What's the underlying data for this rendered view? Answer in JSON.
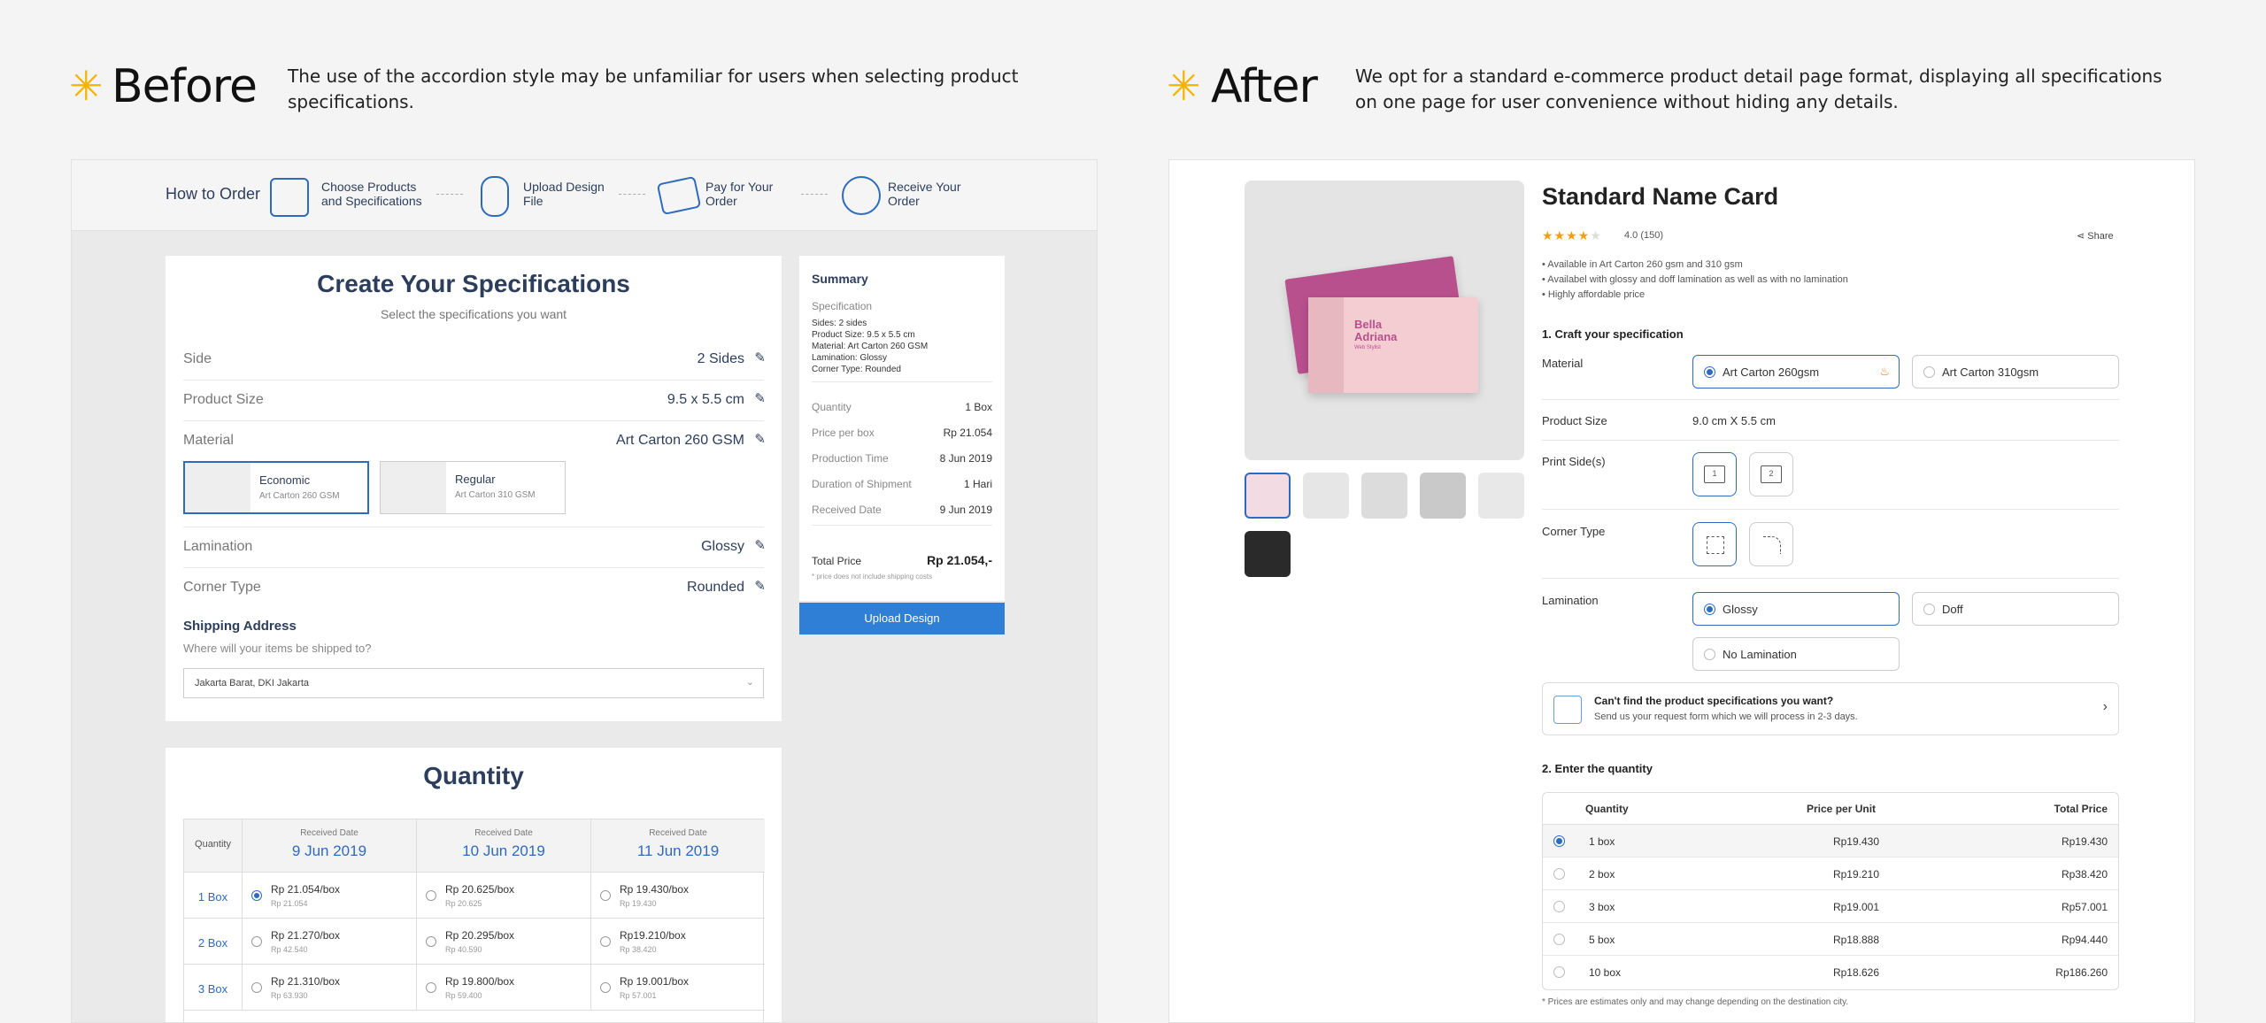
{
  "before": {
    "heading": "Before",
    "description_line1": "The use of the accordion style may be unfamiliar for users when selecting product",
    "description_line2": "specifications.",
    "how_to_order": {
      "label": "How to Order",
      "steps": [
        {
          "line1": "Choose Products",
          "line2": "and Specifications",
          "icon": "computer-icon"
        },
        {
          "line1": "Upload Design",
          "line2": "File",
          "icon": "upload-file-icon"
        },
        {
          "line1": "Pay for Your",
          "line2": "Order",
          "icon": "credit-card-icon"
        },
        {
          "line1": "Receive Your",
          "line2": "Order",
          "icon": "delivery-icon"
        }
      ]
    },
    "spec": {
      "title": "Create Your Specifications",
      "subtitle": "Select the specifications you want",
      "rows": [
        {
          "label": "Side",
          "value": "2 Sides"
        },
        {
          "label": "Product Size",
          "value": "9.5 x 5.5 cm"
        },
        {
          "label": "Material",
          "value": "Art Carton 260 GSM"
        }
      ],
      "materials": [
        {
          "name": "Economic",
          "desc": "Art Carton 260 GSM",
          "selected": true
        },
        {
          "name": "Regular",
          "desc": "Art Carton 310 GSM",
          "selected": false
        }
      ],
      "rows2": [
        {
          "label": "Lamination",
          "value": "Glossy"
        },
        {
          "label": "Corner Type",
          "value": "Rounded"
        }
      ],
      "shipping_title": "Shipping Address",
      "shipping_sub": "Where will your items be shipped to?",
      "shipping_value": "Jakarta Barat, DKI Jakarta"
    },
    "summary": {
      "title": "Summary",
      "spec_label": "Specification",
      "spec_lines": [
        "Sides: 2 sides",
        "Product Size: 9.5 x 5.5 cm",
        "Material: Art Carton 260 GSM",
        "Lamination: Glossy",
        "Corner Type: Rounded"
      ],
      "items": [
        {
          "label": "Quantity",
          "value": "1 Box"
        },
        {
          "label": "Price per box",
          "value": "Rp 21.054"
        },
        {
          "label": "Production Time",
          "value": "8 Jun 2019"
        },
        {
          "label": "Duration of Shipment",
          "value": "1 Hari"
        },
        {
          "label": "Received Date",
          "value": "9 Jun 2019"
        }
      ],
      "total_label": "Total Price",
      "total_value": "Rp 21.054,-",
      "note": "* price does not include shipping costs",
      "button": "Upload Design"
    },
    "quantity": {
      "title": "Quantity",
      "col_header": "Quantity",
      "received_label": "Received Date",
      "dates": [
        "9 Jun 2019",
        "10 Jun 2019",
        "11 Jun 2019"
      ],
      "rows": [
        {
          "qty": "1 Box",
          "cells": [
            {
              "price": "Rp 21.054/box",
              "sub": "Rp 21.054",
              "selected": true
            },
            {
              "price": "Rp 20.625/box",
              "sub": "Rp 20.625",
              "selected": false
            },
            {
              "price": "Rp 19.430/box",
              "sub": "Rp 19.430",
              "selected": false
            }
          ]
        },
        {
          "qty": "2 Box",
          "cells": [
            {
              "price": "Rp 21.270/box",
              "sub": "Rp 42.540",
              "selected": false
            },
            {
              "price": "Rp 20.295/box",
              "sub": "Rp 40.590",
              "selected": false
            },
            {
              "price": "Rp19.210/box",
              "sub": "Rp 38.420",
              "selected": false
            }
          ]
        },
        {
          "qty": "3 Box",
          "cells": [
            {
              "price": "Rp 21.310/box",
              "sub": "Rp 63.930",
              "selected": false
            },
            {
              "price": "Rp 19.800/box",
              "sub": "Rp 59.400",
              "selected": false
            },
            {
              "price": "Rp 19.001/box",
              "sub": "Rp 57.001",
              "selected": false
            }
          ]
        }
      ]
    }
  },
  "after": {
    "heading": "After",
    "description_line1": "We opt for a standard e-commerce product detail page format, displaying all specifications",
    "description_line2": "on one page for user convenience without hiding any details.",
    "product": {
      "title": "Standard Name Card",
      "rating": "4.0 (150)",
      "rating_stars": 4,
      "share": "Share",
      "card_name_1": "Bella",
      "card_name_2": "Adriana",
      "card_role": "Web Stylist",
      "bullets": [
        "• Available in Art Carton 260 gsm and 310 gsm",
        "• Availabel with glossy and doff lamination as well as with no lamination",
        "• Highly affordable price"
      ],
      "section1": "1. Craft your specification",
      "material_label": "Material",
      "materials": [
        {
          "label": "Art Carton 260gsm",
          "selected": true
        },
        {
          "label": "Art Carton 310gsm",
          "selected": false
        }
      ],
      "size_label": "Product Size",
      "size_value": "9.0 cm X 5.5 cm",
      "print_label": "Print Side(s)",
      "print_icons": [
        "1",
        "2"
      ],
      "corner_label": "Corner Type",
      "lamination_label": "Lamination",
      "laminations": [
        {
          "label": "Glossy",
          "selected": true
        },
        {
          "label": "Doff",
          "selected": false
        },
        {
          "label": "No Lamination",
          "selected": false
        }
      ],
      "help_title": "Can't find the product specifications you want?",
      "help_sub": "Send us your request form which we will process in 2-3 days.",
      "section2": "2. Enter the quantity",
      "table_headers": [
        "Quantity",
        "Price per Unit",
        "Total Price"
      ],
      "rows": [
        {
          "qty": "1 box",
          "unit": "Rp19.430",
          "total": "Rp19.430",
          "selected": true
        },
        {
          "qty": "2 box",
          "unit": "Rp19.210",
          "total": "Rp38.420",
          "selected": false
        },
        {
          "qty": "3 box",
          "unit": "Rp19.001",
          "total": "Rp57.001",
          "selected": false
        },
        {
          "qty": "5 box",
          "unit": "Rp18.888",
          "total": "Rp94.440",
          "selected": false
        },
        {
          "qty": "10 box",
          "unit": "Rp18.626",
          "total": "Rp186.260",
          "selected": false
        }
      ],
      "table_note": "* Prices are estimates only and may change depending on the destination city."
    }
  }
}
